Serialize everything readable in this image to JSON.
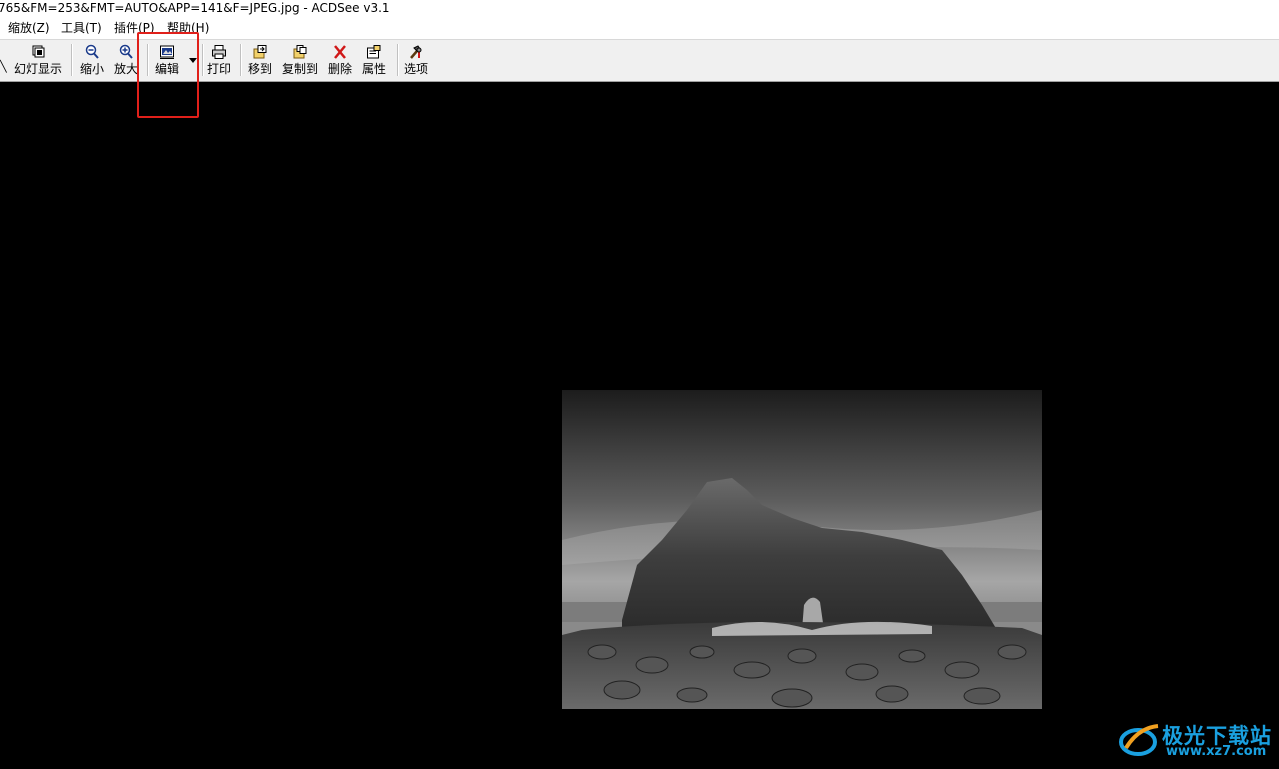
{
  "window": {
    "title": "765&FM=253&FMT=AUTO&APP=141&F=JPEG.jpg - ACDSee v3.1"
  },
  "menu": [
    {
      "label": "缩放(Z)"
    },
    {
      "label": "工具(T)"
    },
    {
      "label": "插件(P)"
    },
    {
      "label": "帮助(H)"
    }
  ],
  "toolbar": {
    "slideshow": {
      "label": "幻灯显示",
      "icon": "slideshow-icon"
    },
    "zoom_out": {
      "label": "缩小",
      "icon": "zoom-out-icon"
    },
    "zoom_in": {
      "label": "放大",
      "icon": "zoom-in-icon"
    },
    "edit": {
      "label": "编辑",
      "icon": "edit-icon"
    },
    "print": {
      "label": "打印",
      "icon": "print-icon"
    },
    "move_to": {
      "label": "移到",
      "icon": "move-to-icon"
    },
    "copy_to": {
      "label": "复制到",
      "icon": "copy-to-icon"
    },
    "delete": {
      "label": "删除",
      "icon": "delete-icon"
    },
    "properties": {
      "label": "属性",
      "icon": "properties-icon"
    },
    "options": {
      "label": "选项",
      "icon": "options-icon"
    }
  },
  "viewer": {
    "background": "#000000",
    "image_description_colors": {
      "sky_top": "#1c1c1c",
      "sky_mid": "#9a9a9a"
    }
  },
  "watermark": {
    "brand": "极光下载站",
    "url": "www.xz7.com"
  },
  "colors": {
    "highlight": "#e0201a",
    "watermark": "#1aa0e0"
  }
}
